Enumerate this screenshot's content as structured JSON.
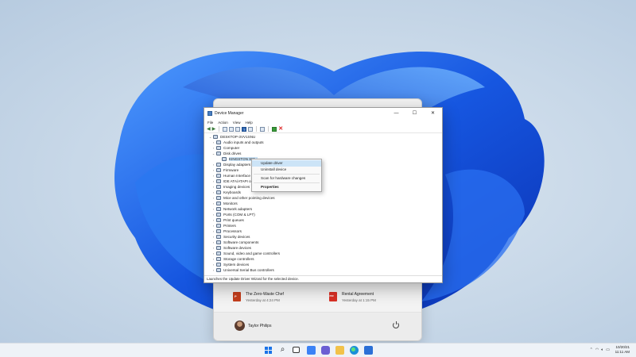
{
  "colors": {
    "accent": "#0067c0",
    "selection": "#cce4f7",
    "powerpoint": "#c43e1c",
    "pdf": "#d93025"
  },
  "start_menu": {
    "recommended": [
      {
        "name": "The Zero-Waste Chef",
        "time": "Yesterday at 4:24 PM",
        "icon": "powerpoint-icon",
        "label": "P"
      },
      {
        "name": "Rental Agreement",
        "time": "Yesterday at 1:15 PM",
        "icon": "pdf-icon",
        "label": "PDF"
      }
    ],
    "user": "Taylor Philips"
  },
  "window": {
    "title": "Device Manager",
    "controls": {
      "minimize": "—",
      "maximize": "☐",
      "close": "✕"
    },
    "menu": [
      "File",
      "Action",
      "View",
      "Help"
    ],
    "status": "Launches the Update Driver Wizard for the selected device."
  },
  "tree": {
    "root": "DESKTOP-3VV1SNU",
    "nodes": [
      {
        "label": "Audio inputs and outputs",
        "level": 1,
        "expanded": false
      },
      {
        "label": "Computer",
        "level": 1,
        "expanded": false
      },
      {
        "label": "Disk drives",
        "level": 1,
        "expanded": true
      },
      {
        "label": "KINGSTON SM...",
        "level": 2,
        "selected": true
      },
      {
        "label": "Display adapters",
        "level": 1,
        "expanded": false
      },
      {
        "label": "Firmware",
        "level": 1,
        "expanded": false
      },
      {
        "label": "Human Interface Devices",
        "level": 1,
        "expanded": false
      },
      {
        "label": "IDE ATA/ATAPI controllers",
        "level": 1,
        "expanded": false
      },
      {
        "label": "Imaging devices",
        "level": 1,
        "expanded": false
      },
      {
        "label": "Keyboards",
        "level": 1,
        "expanded": false
      },
      {
        "label": "Mice and other pointing devices",
        "level": 1,
        "expanded": false
      },
      {
        "label": "Monitors",
        "level": 1,
        "expanded": false
      },
      {
        "label": "Network adapters",
        "level": 1,
        "expanded": false
      },
      {
        "label": "Ports (COM & LPT)",
        "level": 1,
        "expanded": false
      },
      {
        "label": "Print queues",
        "level": 1,
        "expanded": false
      },
      {
        "label": "Printers",
        "level": 1,
        "expanded": false
      },
      {
        "label": "Processors",
        "level": 1,
        "expanded": false
      },
      {
        "label": "Security devices",
        "level": 1,
        "expanded": false
      },
      {
        "label": "Software components",
        "level": 1,
        "expanded": false
      },
      {
        "label": "Software devices",
        "level": 1,
        "expanded": false
      },
      {
        "label": "Sound, video and game controllers",
        "level": 1,
        "expanded": false
      },
      {
        "label": "Storage controllers",
        "level": 1,
        "expanded": false
      },
      {
        "label": "System devices",
        "level": 1,
        "expanded": false
      },
      {
        "label": "Universal Serial Bus controllers",
        "level": 1,
        "expanded": false
      }
    ]
  },
  "context_menu": {
    "update": "Update driver",
    "uninstall": "Uninstall device",
    "scan": "Scan for hardware changes",
    "properties": "Properties"
  },
  "taskbar": {
    "icons": [
      "windows-start-icon",
      "search-icon",
      "task-view-icon",
      "widgets-icon",
      "chat-icon",
      "file-explorer-icon",
      "edge-icon",
      "store-icon"
    ],
    "date": "10/20/21",
    "time": "11:11 AM"
  }
}
